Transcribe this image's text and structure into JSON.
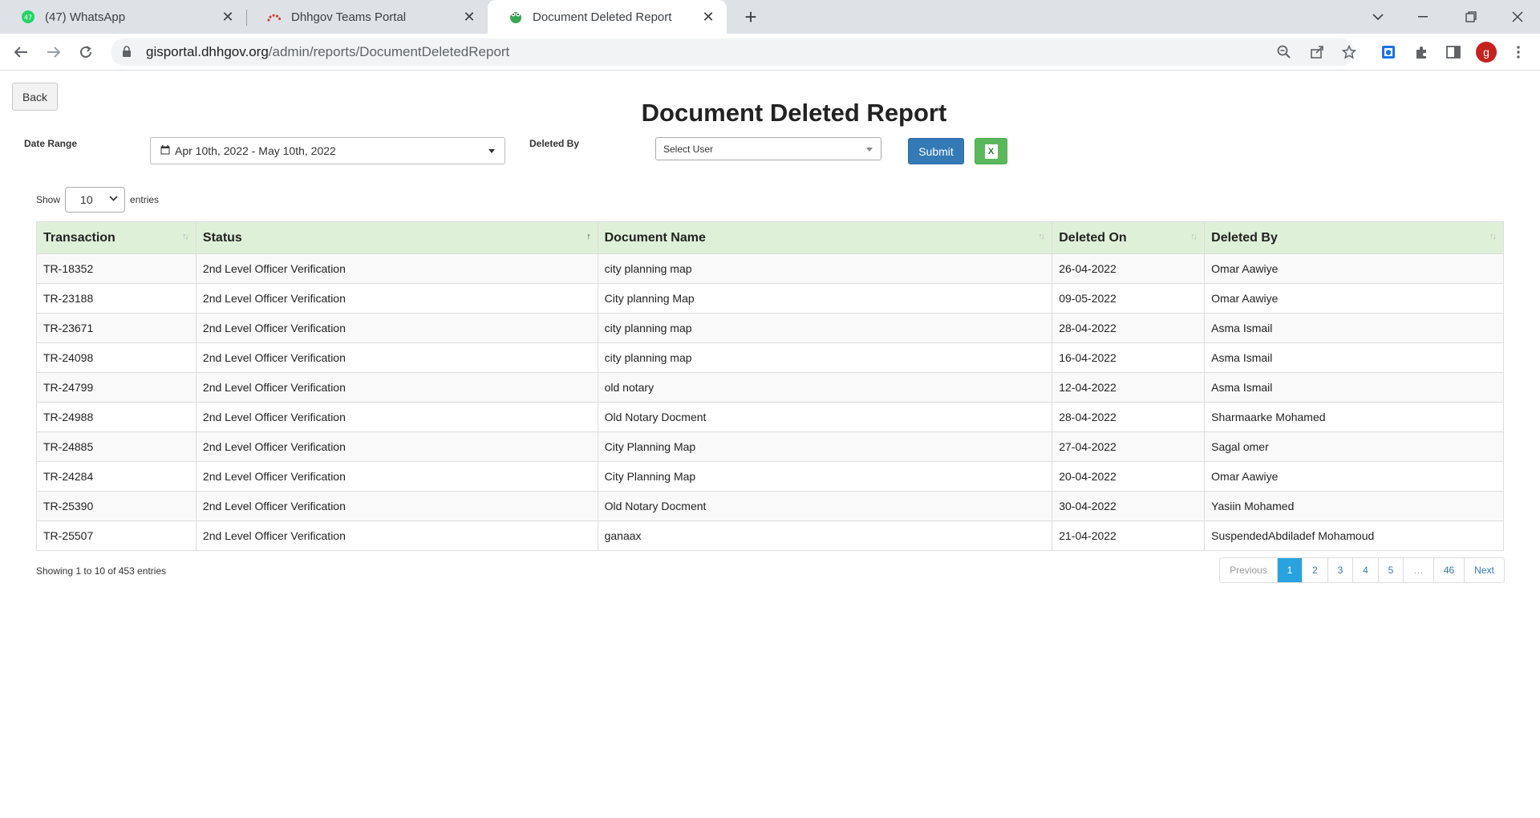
{
  "browser": {
    "tabs": [
      {
        "title": "(47) WhatsApp",
        "badge": "47"
      },
      {
        "title": "Dhhgov Teams Portal"
      },
      {
        "title": "Document Deleted Report"
      }
    ],
    "url_host": "gisportal.dhhgov.org",
    "url_path": "/admin/reports/DocumentDeletedReport",
    "profile_initial": "g"
  },
  "page": {
    "back_label": "Back",
    "title": "Document Deleted Report",
    "date_range_label": "Date Range",
    "date_range_value": "Apr 10th, 2022 - May 10th, 2022",
    "deleted_by_label": "Deleted By",
    "deleted_by_value": "Select User",
    "submit_label": "Submit",
    "excel_icon_text": "X"
  },
  "length": {
    "show": "Show",
    "value": "10",
    "entries": "entries"
  },
  "table": {
    "headers": [
      "Transaction",
      "Status",
      "Document Name",
      "Deleted On",
      "Deleted By"
    ],
    "rows": [
      [
        "TR-18352",
        "2nd Level Officer Verification",
        "city planning map",
        "26-04-2022",
        "Omar Aawiye"
      ],
      [
        "TR-23188",
        "2nd Level Officer Verification",
        "City planning Map",
        "09-05-2022",
        "Omar Aawiye"
      ],
      [
        "TR-23671",
        "2nd Level Officer Verification",
        "city planning map",
        "28-04-2022",
        "Asma Ismail"
      ],
      [
        "TR-24098",
        "2nd Level Officer Verification",
        "city planning map",
        "16-04-2022",
        "Asma Ismail"
      ],
      [
        "TR-24799",
        "2nd Level Officer Verification",
        "old notary",
        "12-04-2022",
        "Asma Ismail"
      ],
      [
        "TR-24988",
        "2nd Level Officer Verification",
        "Old Notary Docment",
        "28-04-2022",
        "Sharmaarke Mohamed"
      ],
      [
        "TR-24885",
        "2nd Level Officer Verification",
        "City Planning Map",
        "27-04-2022",
        "Sagal omer"
      ],
      [
        "TR-24284",
        "2nd Level Officer Verification",
        "City Planning Map",
        "20-04-2022",
        "Omar Aawiye"
      ],
      [
        "TR-25390",
        "2nd Level Officer Verification",
        "Old Notary Docment",
        "30-04-2022",
        "Yasiin Mohamed"
      ],
      [
        "TR-25507",
        "2nd Level Officer Verification",
        "ganaax",
        "21-04-2022",
        "SuspendedAbdiladef Mohamoud"
      ]
    ]
  },
  "info_text": "Showing 1 to 10 of 453 entries",
  "pagination": {
    "previous": "Previous",
    "pages": [
      "1",
      "2",
      "3",
      "4",
      "5",
      "…",
      "46"
    ],
    "next": "Next",
    "active": "1"
  },
  "colors": {
    "header_bg": "#dff0d8",
    "link": "#337ab7",
    "submit": "#337ab7",
    "excel": "#5cb85c",
    "page_active": "#29a3e0"
  }
}
